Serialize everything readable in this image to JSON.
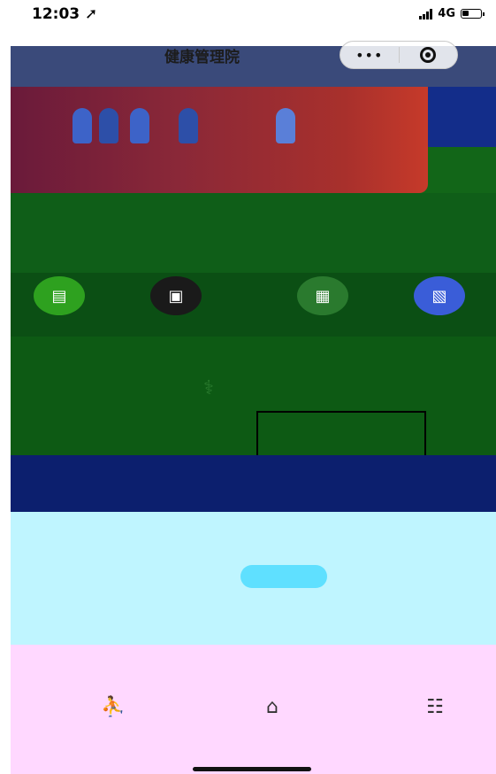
{
  "status_bar": {
    "time": "12:03",
    "network": "4G"
  },
  "nav": {
    "title": "健康管理院",
    "menu_icon": "more-dots-icon",
    "close_icon": "target-circle-icon"
  },
  "quick_icons": [
    {
      "icon": "id-card-icon",
      "color": "#2ea11f"
    },
    {
      "icon": "ticket-icon",
      "color": "#222222"
    },
    {
      "icon": "calendar-icon",
      "color": "#2a7a2e"
    },
    {
      "icon": "photo-icon",
      "color": "#3a5dd8"
    }
  ],
  "colors": {
    "banner": "#132d8a",
    "green": "#0d5a14",
    "navy": "#0c1f6e",
    "cyan": "#bff5ff",
    "pink": "#ffd8ff"
  }
}
